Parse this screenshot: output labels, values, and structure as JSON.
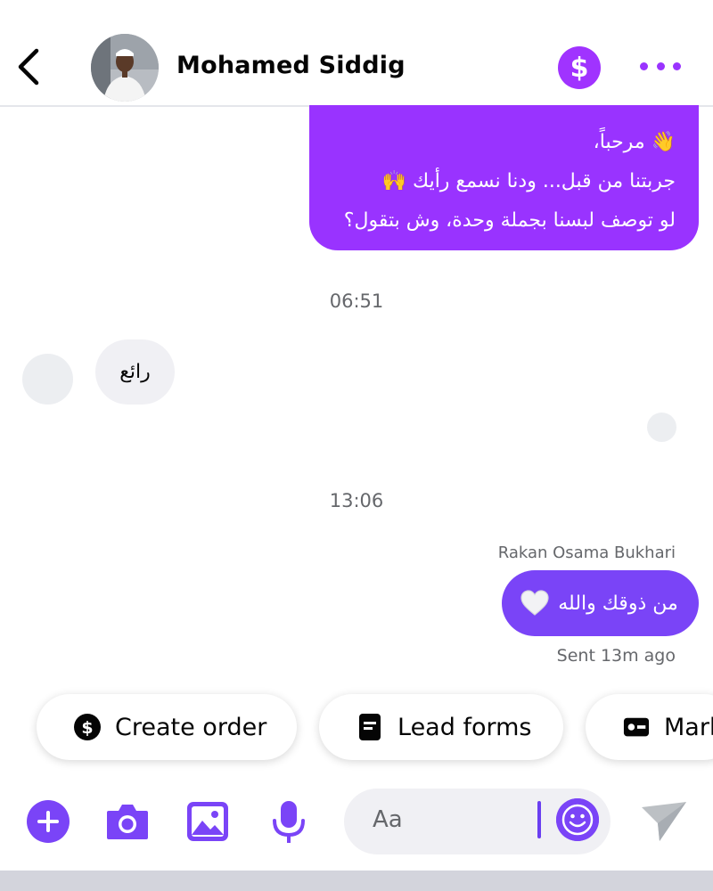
{
  "header": {
    "contact_name": "Mohamed Siddig",
    "payment_icon": "dollar-icon",
    "more_icon": "more-dots-icon",
    "back_icon": "chevron-left-icon"
  },
  "messages": {
    "outgoing_1": {
      "lines": [
        "👋 مرحباً،",
        "جربتنا من قبل... ودنا نسمع رأيك 🙌",
        "لو توصف لبسنا بجملة وحدة، وش بتقول؟"
      ]
    },
    "timestamp_1": "06:51",
    "incoming_1": {
      "text": "رائع"
    },
    "timestamp_2": "13:06",
    "outgoing_2": {
      "sender": "Rakan Osama Bukhari",
      "text": "من ذوقك والله",
      "emoji": "white-heart-icon",
      "status": "Sent 13m ago"
    }
  },
  "quick_replies": [
    {
      "label": "Create order",
      "icon": "dollar-circle-icon"
    },
    {
      "label": "Lead forms",
      "icon": "form-icon"
    },
    {
      "label": "Mark",
      "icon": "card-icon"
    }
  ],
  "composer": {
    "placeholder": "Aa",
    "icons": [
      "plus-icon",
      "camera-icon",
      "image-icon",
      "microphone-icon",
      "emoji-icon",
      "send-icon"
    ]
  },
  "colors": {
    "accent": "#7a44f7",
    "bubble_purple": "#9933ff",
    "incoming_bubble": "#f0f0f4",
    "secondary_text": "#65676b"
  }
}
